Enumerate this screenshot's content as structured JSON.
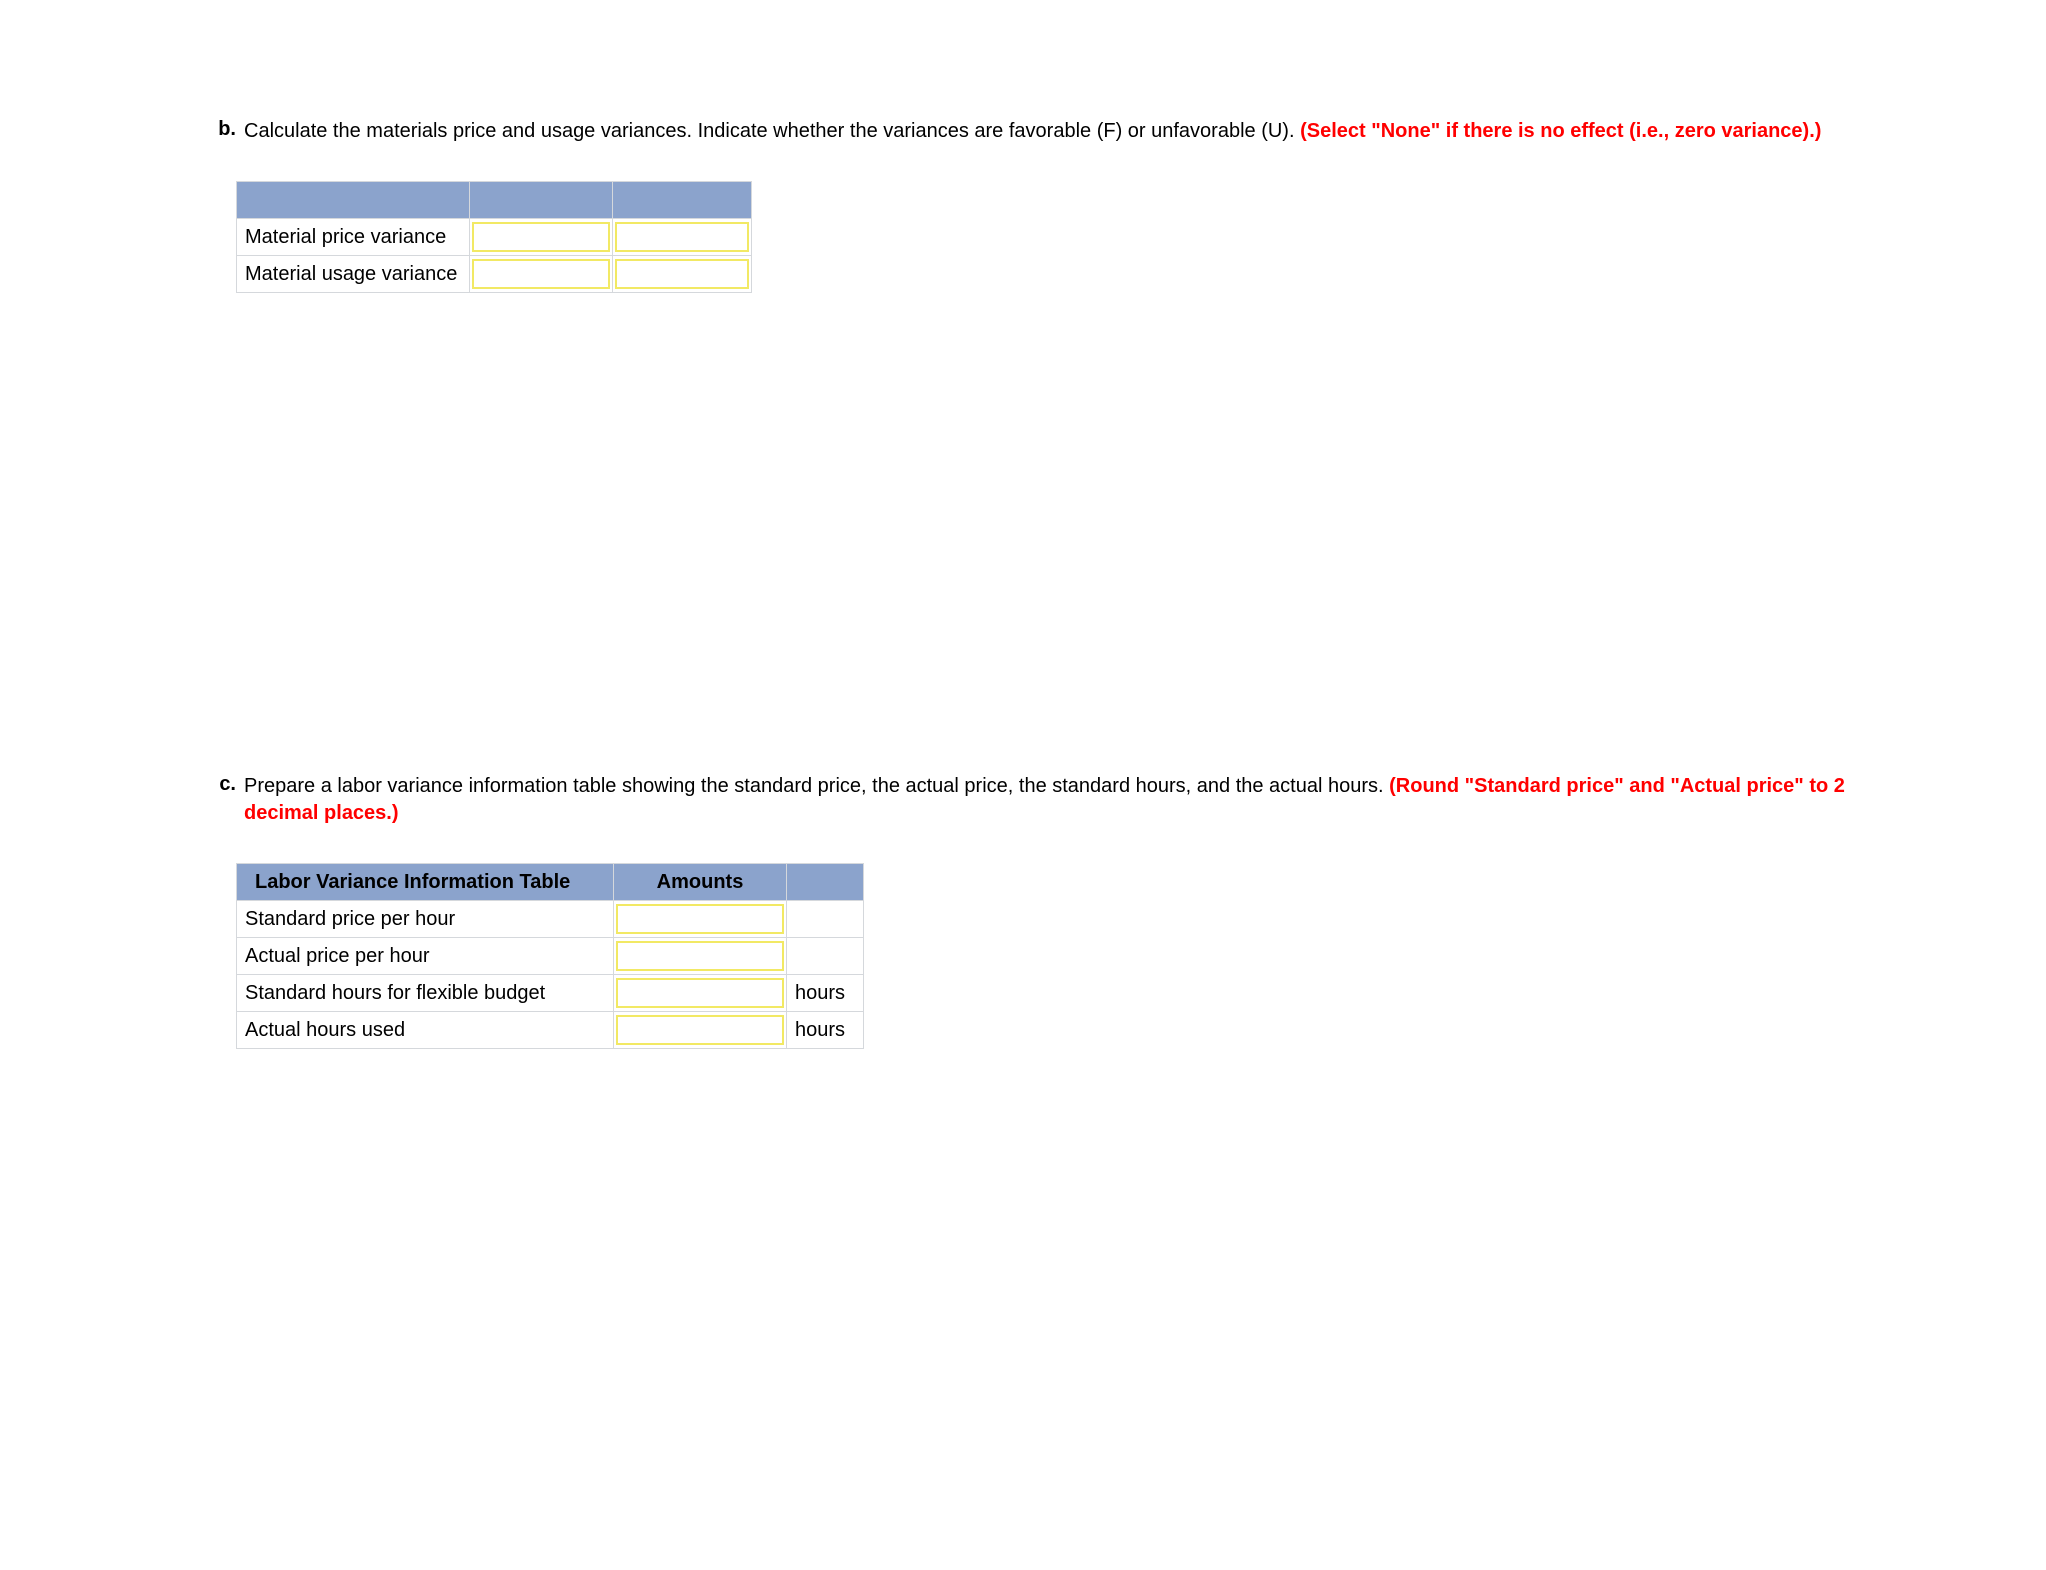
{
  "questions": {
    "b": {
      "letter": "b.",
      "text_plain": "Calculate the materials price and usage variances. Indicate whether the variances are favorable (F) or unfavorable (U). ",
      "text_red": "(Select \"None\" if there is no effect (i.e., zero variance).)"
    },
    "c": {
      "letter": "c.",
      "text_plain": "Prepare a labor variance information table showing the standard price, the actual price, the standard hours, and the actual hours. ",
      "text_red": "(Round \"Standard price\" and \"Actual price\" to 2 decimal places.)"
    }
  },
  "table_b": {
    "header": {
      "col1": "",
      "col2": "",
      "col3": ""
    },
    "rows": [
      {
        "label": "Material price variance",
        "value": "",
        "fu": ""
      },
      {
        "label": "Material usage variance",
        "value": "",
        "fu": ""
      }
    ]
  },
  "table_c": {
    "header": {
      "col1": "Labor Variance Information Table",
      "col2": "Amounts",
      "col3": ""
    },
    "rows": [
      {
        "label": "Standard price per hour",
        "value": "",
        "unit": ""
      },
      {
        "label": "Actual price per hour",
        "value": "",
        "unit": ""
      },
      {
        "label": "Standard hours for flexible budget",
        "value": "",
        "unit": "hours"
      },
      {
        "label": "Actual hours used",
        "value": "",
        "unit": "hours"
      }
    ]
  }
}
